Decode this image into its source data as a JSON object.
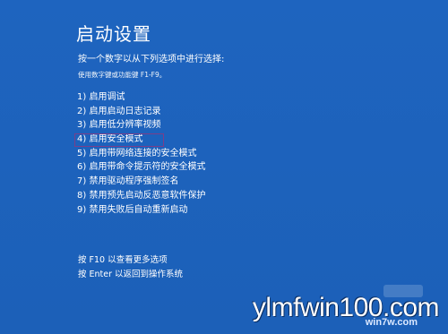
{
  "screen": {
    "title": "启动设置",
    "subtitle": "按一个数字以从下列选项中进行选择:",
    "hint": "使用数字键或功能键 F1-F9。",
    "options": [
      {
        "label": "1) 启用调试",
        "selected": false
      },
      {
        "label": "2) 启用启动日志记录",
        "selected": false
      },
      {
        "label": "3) 启用低分辨率视频",
        "selected": false
      },
      {
        "label": "4) 启用安全模式",
        "selected": true
      },
      {
        "label": "5) 启用带网络连接的安全模式",
        "selected": false
      },
      {
        "label": "6) 启用带命令提示符的安全模式",
        "selected": false
      },
      {
        "label": "7) 禁用驱动程序强制签名",
        "selected": false
      },
      {
        "label": "8) 禁用预先启动反恶意软件保护",
        "selected": false
      },
      {
        "label": "9) 禁用失败后自动重新启动",
        "selected": false
      }
    ],
    "footer": {
      "more_options": "按 F10 以查看更多选项",
      "return": "按 Enter 以返回到操作系统"
    }
  },
  "watermark": {
    "domain": "ylmfwin100.com",
    "sub": "win7w.com"
  },
  "colors": {
    "background": "#1f66c0",
    "text": "#ffffff",
    "selection_border": "#7a3f8a"
  }
}
